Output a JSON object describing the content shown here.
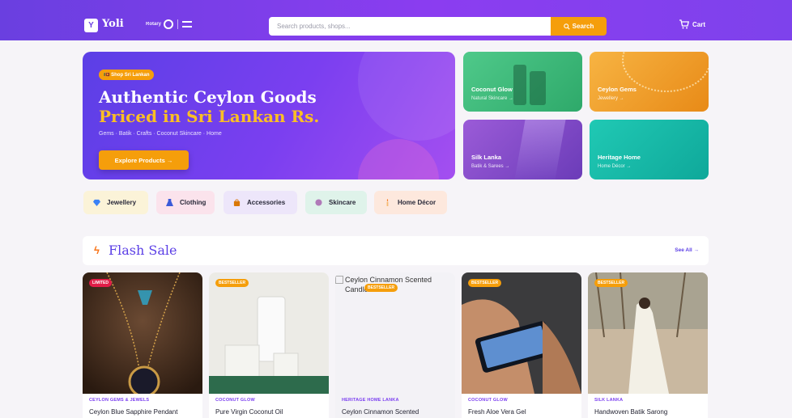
{
  "header": {
    "logo_mark": "Y",
    "brand": "Yoli",
    "partner_text": "Rotary",
    "search_placeholder": "Search products, shops...",
    "search_button": "Search",
    "cart_label": "Cart"
  },
  "hero": {
    "pill": "🇱🇰 Shop Sri Lankan",
    "title_line1": "Authentic Ceylon Goods",
    "title_line2": "Priced in Sri Lankan Rs.",
    "subtitle": "Gems · Batik · Crafts · Coconut Skincare · Home",
    "cta": "Explore Products →"
  },
  "promos": [
    {
      "title": "Coconut Glow",
      "subtitle": "Natural Skincare →"
    },
    {
      "title": "Ceylon Gems",
      "subtitle": "Jewellery →"
    },
    {
      "title": "Silk Lanka",
      "subtitle": "Batik & Sarees →"
    },
    {
      "title": "Heritage Home",
      "subtitle": "Home Décor →"
    }
  ],
  "categories": [
    {
      "label": "Jewellery",
      "icon": "gem-icon"
    },
    {
      "label": "Clothing",
      "icon": "dress-icon"
    },
    {
      "label": "Accessories",
      "icon": "bag-icon"
    },
    {
      "label": "Skincare",
      "icon": "lotion-icon"
    },
    {
      "label": "Home Décor",
      "icon": "candle-icon"
    }
  ],
  "flash_sale": {
    "title": "Flash Sale",
    "see_all": "See All →"
  },
  "products": [
    {
      "badge": "LIMITED",
      "shop": "CEYLON GEMS & JEWELS",
      "name": "Ceylon Blue Sapphire Pendant"
    },
    {
      "badge": "BESTSELLER",
      "shop": "COCONUT GLOW",
      "name": "Pure Virgin Coconut Oil"
    },
    {
      "badge": "BESTSELLER",
      "shop": "HERITAGE HOME LANKA",
      "name": "Ceylon Cinnamon Scented",
      "alt_text": "Ceylon Cinnamon Scented Candle"
    },
    {
      "badge": "BESTSELLER",
      "shop": "COCONUT GLOW",
      "name": "Fresh Aloe Vera Gel"
    },
    {
      "badge": "BESTSELLER",
      "shop": "SILK LANKA",
      "name": "Handwoven Batik Sarong"
    }
  ],
  "colors": {
    "brand": "#6a3fe0",
    "accent": "#f59e0b",
    "badge_limited": "#e11d48"
  }
}
